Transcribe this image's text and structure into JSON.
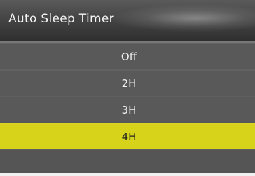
{
  "dialog": {
    "title": "Auto Sleep Timer",
    "options": [
      {
        "label": "Off",
        "selected": false
      },
      {
        "label": "2H",
        "selected": false
      },
      {
        "label": "3H",
        "selected": false
      },
      {
        "label": "4H",
        "selected": true
      }
    ],
    "colors": {
      "item_bg": "#595959",
      "selected_bg": "#d7d31a",
      "text": "#f2f2f2",
      "selected_text": "#222222"
    }
  }
}
